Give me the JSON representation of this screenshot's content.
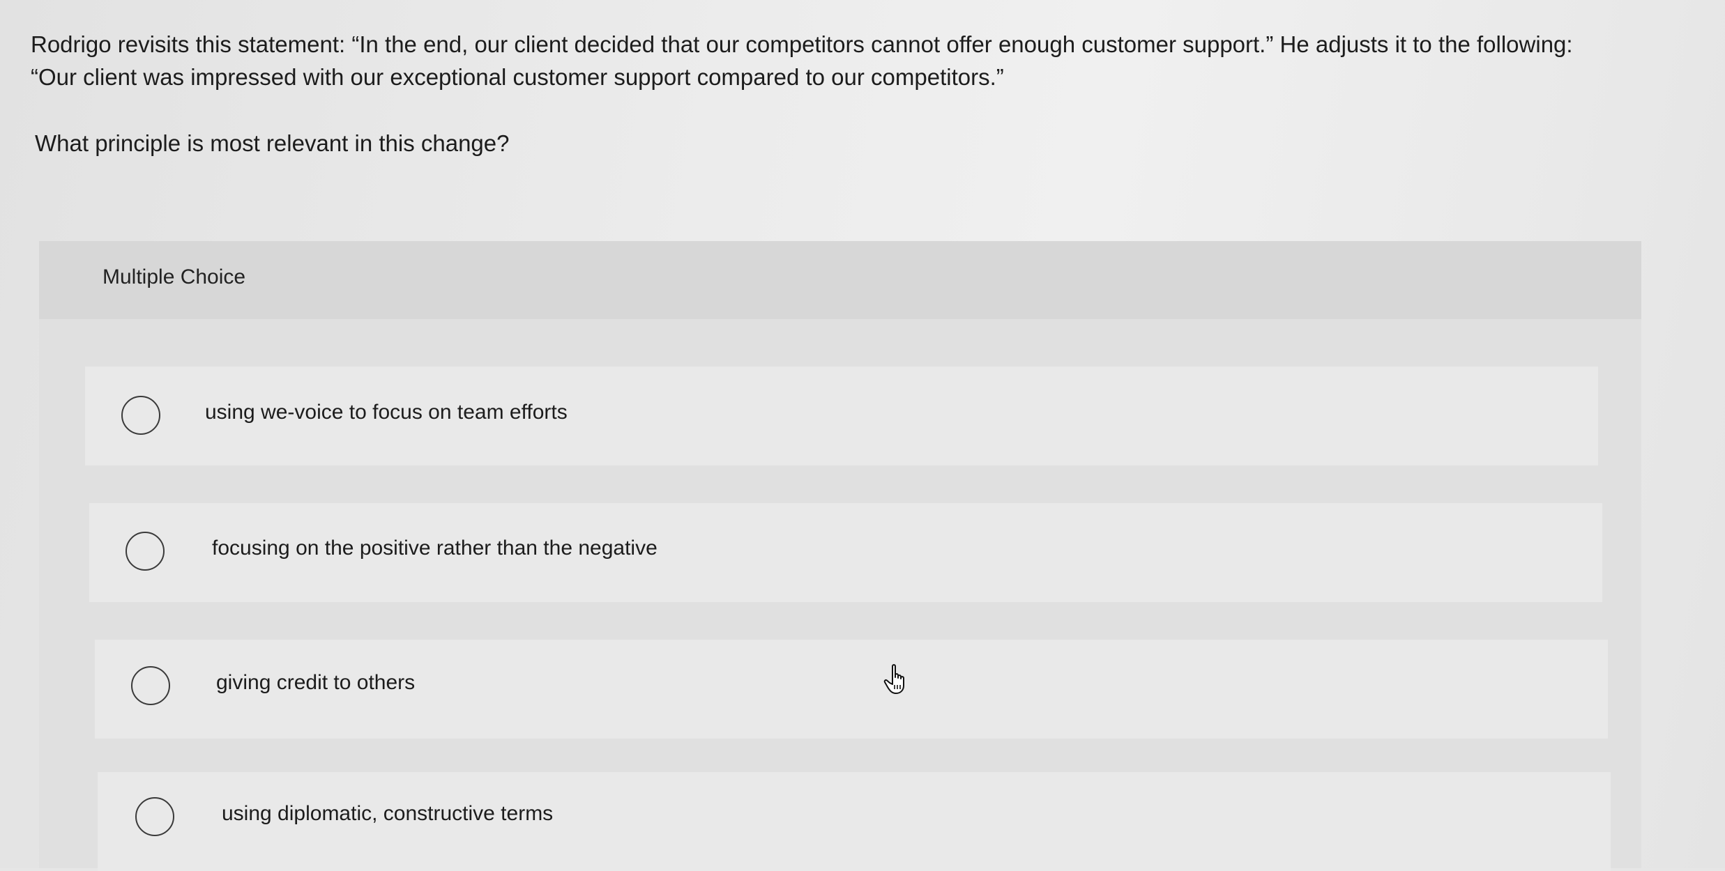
{
  "question": {
    "statement_line1": "Rodrigo revisits this statement: “In the end, our client decided that our competitors cannot offer enough customer support.” He adjusts it to the following:",
    "statement_line2": "“Our client was impressed with our exceptional customer support compared to our competitors.”",
    "prompt": "What principle is most relevant in this change?"
  },
  "multiple_choice": {
    "header": "Multiple Choice",
    "options": [
      {
        "label": "using we-voice to focus on team efforts",
        "selected": false
      },
      {
        "label": "focusing on the positive rather than the negative",
        "selected": false
      },
      {
        "label": "giving credit to others",
        "selected": false
      },
      {
        "label": "using diplomatic, constructive terms",
        "selected": false
      }
    ]
  },
  "cursor": {
    "icon": "hand-pointer-icon"
  }
}
